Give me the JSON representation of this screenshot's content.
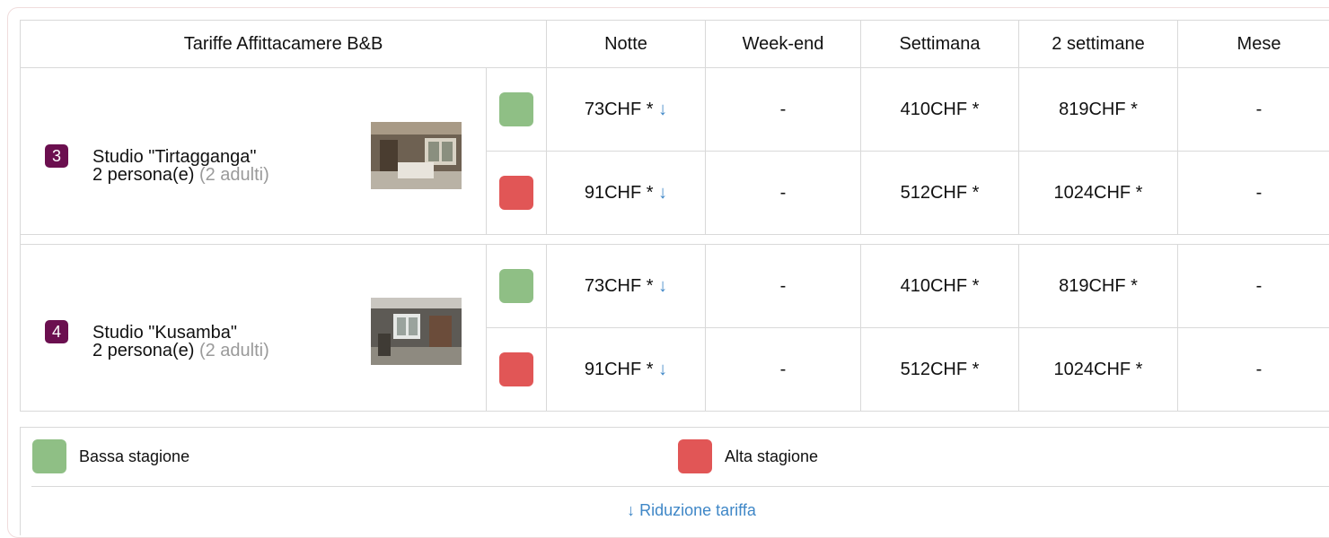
{
  "table": {
    "headers": [
      "Tariffe Affittacamere B&B",
      "Notte",
      "Week-end",
      "Settimana",
      "2 settimane",
      "Mese"
    ],
    "rooms": [
      {
        "number": "3",
        "name": "Studio \"Tirtagganga\"",
        "occupancy": "2 persona(e)",
        "occupancy_detail": "(2 adulti)",
        "photo_icon": "room-photo",
        "rates": [
          {
            "season": "low",
            "color": "#8fbf85",
            "notte": "73CHF *",
            "notte_icon": "↓",
            "weekend": "-",
            "settimana": "410CHF *",
            "due_settimane": "819CHF *",
            "mese": "-"
          },
          {
            "season": "high",
            "color": "#e15656",
            "notte": "91CHF *",
            "notte_icon": "↓",
            "weekend": "-",
            "settimana": "512CHF *",
            "due_settimane": "1024CHF *",
            "mese": "-"
          }
        ]
      },
      {
        "number": "4",
        "name": "Studio \"Kusamba\"",
        "occupancy": "2 persona(e)",
        "occupancy_detail": "(2 adulti)",
        "photo_icon": "room-photo",
        "rates": [
          {
            "season": "low",
            "color": "#8fbf85",
            "notte": "73CHF *",
            "notte_icon": "↓",
            "weekend": "-",
            "settimana": "410CHF *",
            "due_settimane": "819CHF *",
            "mese": "-"
          },
          {
            "season": "high",
            "color": "#e15656",
            "notte": "91CHF *",
            "notte_icon": "↓",
            "weekend": "-",
            "settimana": "512CHF *",
            "due_settimane": "1024CHF *",
            "mese": "-"
          }
        ]
      }
    ]
  },
  "legend": {
    "low_label": "Bassa stagione",
    "high_label": "Alta stagione",
    "note": "↓ Riduzione tariffa"
  },
  "colors": {
    "badge": "#6b0f4f",
    "low_season": "#8fbf85",
    "high_season": "#e15656",
    "link": "#3f87c7"
  }
}
